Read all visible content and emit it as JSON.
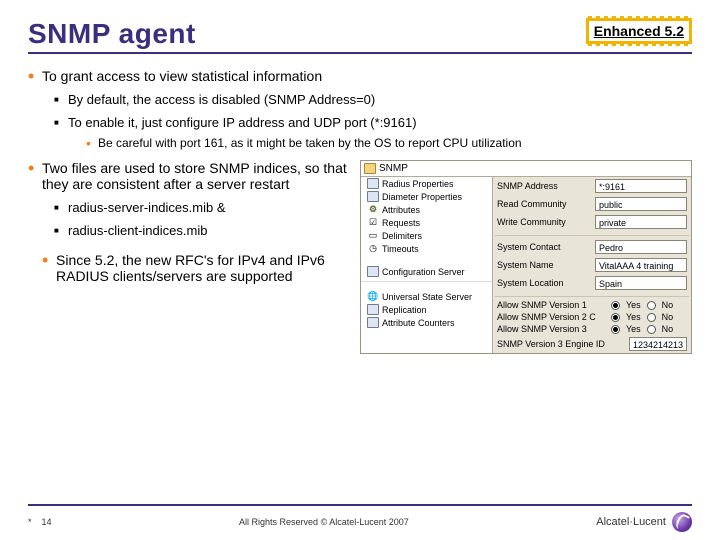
{
  "title": "SNMP agent",
  "badge": "Enhanced 5.2",
  "bullets": {
    "b1_0": "To grant access to view statistical information",
    "b1_0_sub": {
      "s0": "By default, the access is disabled (SNMP Address=0)",
      "s1": "To enable it, just configure IP address and UDP port (*:9161)",
      "s1_sub0": "Be careful with port 161, as it might be taken by the OS to report CPU utilization"
    },
    "b1_1": "Two files are used to store SNMP indices, so that they are consistent after a server restart",
    "b1_1_sub": {
      "s0": "radius-server-indices.mib &",
      "s1": "radius-client-indices.mib"
    },
    "b1_2": "Since 5.2, the new RFC's for IPv4 and IPv6 RADIUS clients/servers are supported"
  },
  "shot": {
    "header": "SNMP",
    "tree": {
      "t0": "Radius Properties",
      "t1": "Diameter Properties",
      "t2": "Attributes",
      "t3": "Requests",
      "t4": "Delimiters",
      "t5": "Timeouts",
      "t6": "Configuration Server",
      "t7": "Universal State Server",
      "t8": "Replication",
      "t9": "Attribute Counters"
    },
    "form": {
      "f0": {
        "label": "SNMP Address",
        "value": "*:9161"
      },
      "f1": {
        "label": "Read Community",
        "value": "public"
      },
      "f2": {
        "label": "Write Community",
        "value": "private"
      },
      "f3": {
        "label": "System Contact",
        "value": "Pedro"
      },
      "f4": {
        "label": "System Name",
        "value": "VitalAAA 4 training"
      },
      "f5": {
        "label": "System Location",
        "value": "Spain"
      },
      "r0": {
        "label": "Allow SNMP Version 1",
        "yes": "Yes",
        "no": "No"
      },
      "r1": {
        "label": "Allow SNMP Version 2 C",
        "yes": "Yes",
        "no": "No"
      },
      "r2": {
        "label": "Allow SNMP Version 3",
        "yes": "Yes",
        "no": "No"
      },
      "f6": {
        "label": "SNMP Version 3 Engine ID",
        "value": "1234214213"
      }
    }
  },
  "footer": {
    "star": "*",
    "page": "14",
    "copyright": "All Rights Reserved © Alcatel-Lucent 2007",
    "brand": "Alcatel·Lucent"
  }
}
